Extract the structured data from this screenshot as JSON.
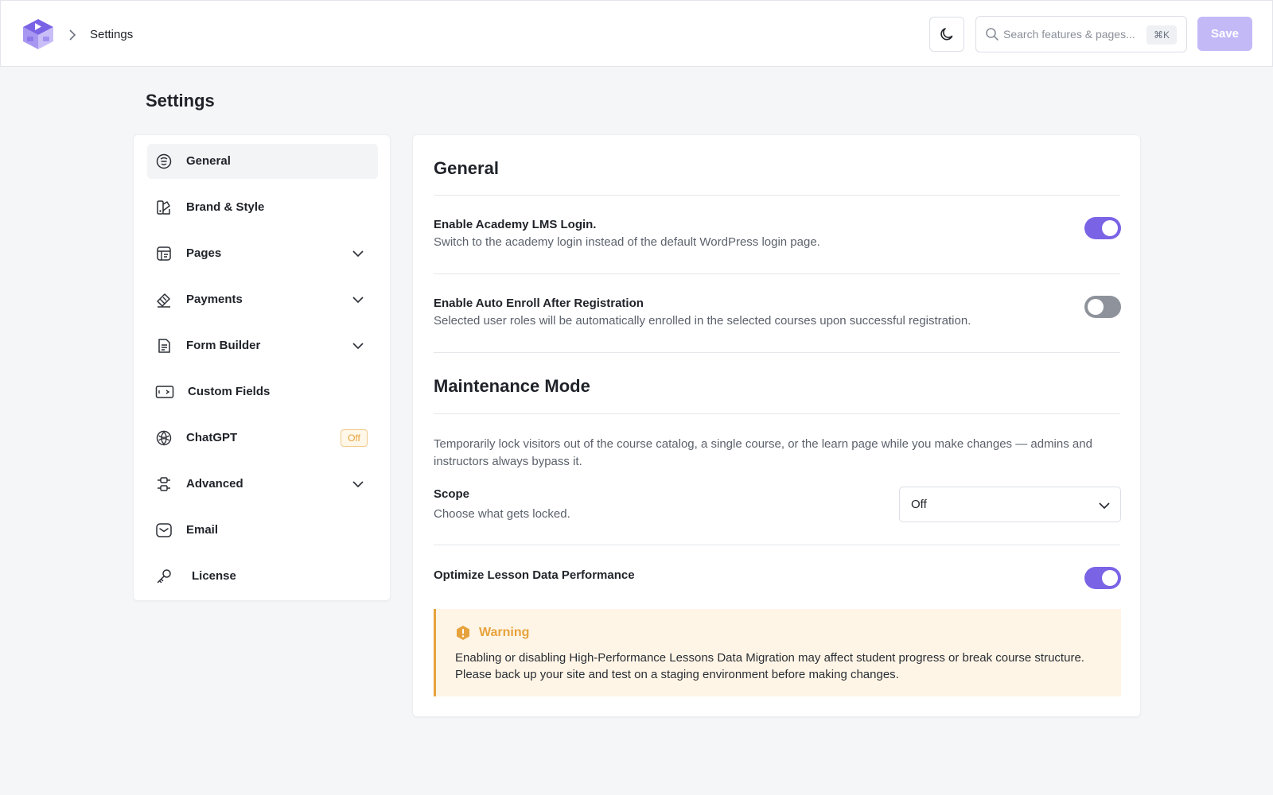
{
  "header": {
    "breadcrumb_label": "Settings",
    "search": {
      "placeholder": "Search features & pages...",
      "shortcut": "⌘K"
    },
    "save_label": "Save",
    "icons": {
      "logo": "academy-cube-logo",
      "theme": "moon-icon",
      "search": "search-icon",
      "breadcrumb": "chevron-right-icon"
    }
  },
  "page_title": "Settings",
  "sidebar": {
    "items": [
      {
        "label": "General",
        "icon": "general-icon",
        "active": true
      },
      {
        "label": "Brand & Style",
        "icon": "brush-icon"
      },
      {
        "label": "Pages",
        "icon": "pages-icon",
        "expandable": true
      },
      {
        "label": "Payments",
        "icon": "payments-icon",
        "expandable": true
      },
      {
        "label": "Form Builder",
        "icon": "form-icon",
        "expandable": true
      },
      {
        "label": "Custom Fields",
        "icon": "custom-fields-icon"
      },
      {
        "label": "ChatGPT",
        "icon": "chatgpt-icon",
        "badge": "Off"
      },
      {
        "label": "Advanced",
        "icon": "sliders-icon",
        "expandable": true
      },
      {
        "label": "Email",
        "icon": "mail-icon"
      },
      {
        "label": "License",
        "icon": "key-icon"
      }
    ]
  },
  "main": {
    "general_title": "General",
    "lms_login": {
      "title": "Enable Academy LMS Login.",
      "desc": "Switch to the academy login instead of the default WordPress login page.",
      "enabled": true
    },
    "auto_enroll": {
      "title": "Enable Auto Enroll After Registration",
      "desc": "Selected user roles will be automatically enrolled in the selected courses upon successful registration.",
      "enabled": false
    },
    "maintenance": {
      "title": "Maintenance Mode",
      "desc_line1": "Temporarily lock visitors out of the course catalog, a single course, or the learn page while you make changes — admins and",
      "desc_line2": "instructors always bypass it.",
      "scope_title": "Scope",
      "scope_desc": "Choose what gets locked.",
      "scope_value": "Off"
    },
    "optimize": {
      "title": "Optimize Lesson Data Performance",
      "enabled": true
    },
    "warning": {
      "title": "Warning",
      "line1": "Enabling or disabling High-Performance Lessons Data Migration may affect student progress or break course structure.",
      "line2": "Please back up your site and test on a staging environment before making changes."
    }
  },
  "colors": {
    "accent": "#7b63e6",
    "save_disabled": "#c4b9f7",
    "warning": "#e6a23c",
    "warning_bg": "#fff5e6"
  }
}
